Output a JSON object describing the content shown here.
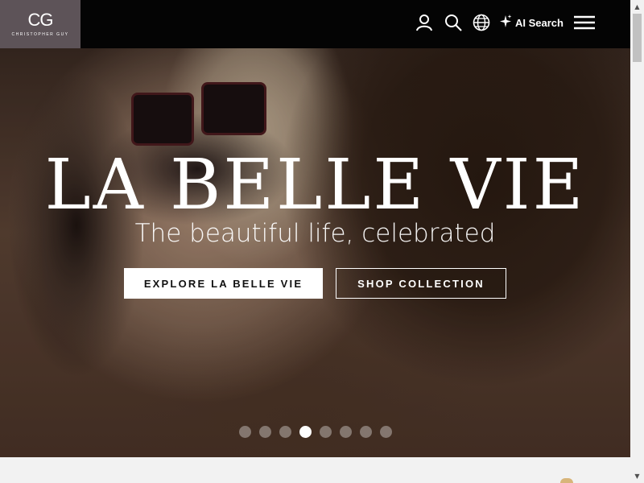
{
  "header": {
    "logo": {
      "mark": "CG",
      "name": "CHRISTOPHER GUY"
    },
    "icons": {
      "account": "user-icon",
      "search": "search-icon",
      "language": "globe-icon",
      "ai": "sparkle-icon",
      "menu": "hamburger-menu-icon"
    },
    "ai_search_label": "AI Search"
  },
  "hero": {
    "title": "LA BELLE VIE",
    "subtitle": "The beautiful life, celebrated",
    "primary_button": "EXPLORE LA BELLE VIE",
    "secondary_button": "SHOP COLLECTION",
    "carousel": {
      "total": 8,
      "active": 4
    }
  },
  "colors": {
    "topbar": "#040404",
    "logo_bg": "#5d5358",
    "accent_gold": "#d8b57a"
  }
}
